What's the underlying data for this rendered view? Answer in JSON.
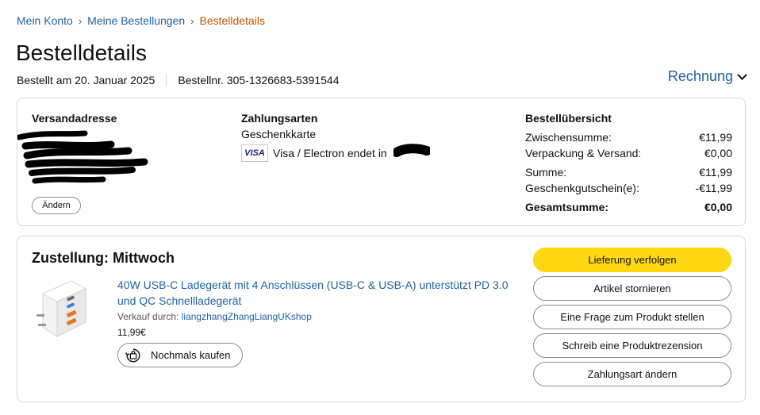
{
  "breadcrumb": {
    "items": [
      "Mein Konto",
      "Meine Bestellungen"
    ],
    "separator": "›",
    "current": "Bestelldetails"
  },
  "page": {
    "title": "Bestelldetails",
    "ordered_on": "Bestellt am 20. Januar 2025",
    "order_number": "Bestellnr. 305-1326683-5391544",
    "invoice_label": "Rechnung"
  },
  "summary": {
    "shipping_title": "Versandadresse",
    "edit_label": "Ändern",
    "payment_title": "Zahlungsarten",
    "payment_method_1": "Geschenkkarte",
    "card_brand": "VISA",
    "payment_method_2": "Visa / Electron endet in",
    "overview_title": "Bestellübersicht",
    "rows": [
      {
        "label": "Zwischensumme:",
        "value": "€11,99"
      },
      {
        "label": "Verpackung & Versand:",
        "value": "€0,00"
      },
      {
        "label": "Summe:",
        "value": "€11,99"
      },
      {
        "label": "Geschenkgutschein(e):",
        "value": "-€11,99"
      }
    ],
    "total": {
      "label": "Gesamtsumme:",
      "value": "€0,00"
    }
  },
  "delivery": {
    "title": "Zustellung: Mittwoch",
    "product_title": "40W USB-C Ladegerät mit 4 Anschlüssen (USB-C & USB-A) unterstützt PD 3.0 und QC Schnellladegerät",
    "seller_prefix": "Verkauf durch:",
    "seller_name": "liangzhangZhangLiangUKshop",
    "price": "11,99€",
    "rebuy_label": "Nochmals kaufen",
    "actions": {
      "track": "Lieferung verfolgen",
      "cancel": "Artikel stornieren",
      "question": "Eine Frage zum Produkt stellen",
      "review": "Schreib eine Produktrezension",
      "change_payment": "Zahlungsart ändern"
    }
  },
  "colors": {
    "link": "#2162a1",
    "current_crumb": "#c45500",
    "primary_button": "#ffd814",
    "border": "#d5d9d9"
  }
}
